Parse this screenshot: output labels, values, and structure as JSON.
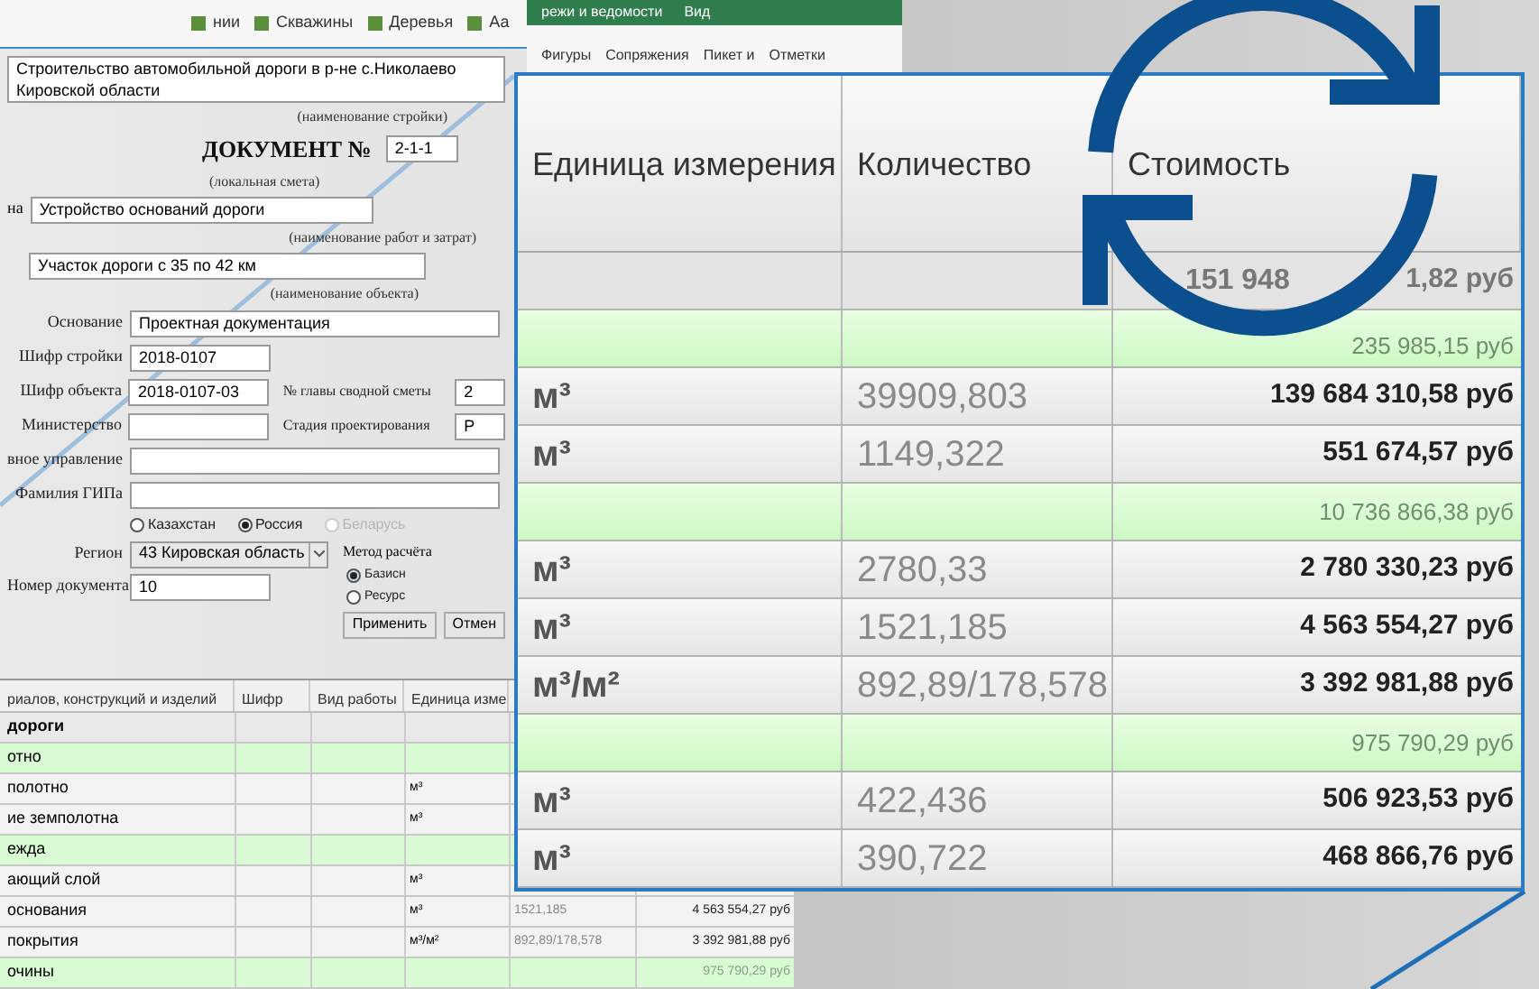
{
  "ribbon": {
    "items": [
      "нии",
      "Скважины",
      "Деревья",
      "Аа"
    ],
    "tabs": [
      "режи и ведомости",
      "Вид"
    ],
    "tools": [
      "Фигуры",
      "Сопряжения",
      "Пикет и",
      "Отметки"
    ]
  },
  "document": {
    "project": "Строительство автомобильной дороги в р-не с.Николаево Кировской области",
    "project_caption": "(наименование стройки)",
    "heading": "ДОКУМЕНТ №",
    "number": "2-1-1",
    "number_caption": "(локальная смета)",
    "work_label": "на",
    "work": "Устройство оснований дороги",
    "work_caption": "(наименование работ и затрат)",
    "object": "Участок дороги с 35 по 42 км",
    "object_caption": "(наименование объекта)",
    "fields": [
      {
        "label": "Основание",
        "value": "Проектная документация",
        "kind": "wide"
      },
      {
        "label": "Шифр стройки",
        "value": "2018-0107",
        "kind": "short"
      },
      {
        "label": "Шифр объекта",
        "value": "2018-0107-03",
        "kind": "short",
        "side": {
          "label": "№ главы сводной сметы",
          "value": "2"
        }
      },
      {
        "label": "Министерство",
        "kind": "short",
        "side": {
          "label": "Стадия проектирования",
          "value": "Р"
        }
      },
      {
        "label": "вное управление",
        "kind": "wide"
      },
      {
        "label": "Фамилия ГИПа",
        "kind": "wide"
      }
    ],
    "countries": [
      {
        "label": "Казахстан",
        "selected": false,
        "disabled": false
      },
      {
        "label": "Россия",
        "selected": true,
        "disabled": false
      },
      {
        "label": "Беларусь",
        "selected": false,
        "disabled": true
      }
    ],
    "region": {
      "label": "Регион",
      "value": "43 Кировская область"
    },
    "doc_no": {
      "label": "Номер документа",
      "value": "10"
    },
    "method": {
      "label": "Метод расчёта",
      "options": [
        {
          "label": "Базисн",
          "selected": true
        },
        {
          "label": "Ресурс",
          "selected": false
        }
      ]
    },
    "buttons": [
      "Применить",
      "Отмен"
    ]
  },
  "table": {
    "columns": [
      "риалов, конструкций и изделий",
      "Шифр",
      "Вид работы",
      "Единица изме"
    ],
    "rows": [
      {
        "kind": "section",
        "name": "дороги"
      },
      {
        "kind": "group",
        "name": "отно"
      },
      {
        "kind": "item",
        "name": "полотно",
        "unit": "м³"
      },
      {
        "kind": "item",
        "name": "ие земполотна",
        "unit": "м³"
      },
      {
        "kind": "group",
        "name": "ежда"
      },
      {
        "kind": "item",
        "name": "ающий слой",
        "unit": "м³"
      },
      {
        "kind": "item",
        "name": "основания",
        "unit": "м³",
        "quantity": "1521,185",
        "cost": "4 563 554,27 руб"
      },
      {
        "kind": "item",
        "name": "покрытия",
        "unit": "м³/м²",
        "quantity": "892,89/178,578",
        "cost": "3 392 981,88 руб"
      },
      {
        "kind": "group",
        "name": "очины",
        "cost": "975 790,29 руб"
      }
    ]
  },
  "zoomed_table": {
    "columns": [
      "Единица измерения",
      "Количество",
      "Стоимость"
    ],
    "rows": [
      {
        "kind": "total",
        "cost_lead": "151 948",
        "cost": "1,82 руб"
      },
      {
        "kind": "group",
        "cost": "235 985,15 руб"
      },
      {
        "kind": "item",
        "unit": "м³",
        "quantity": "39909,803",
        "cost": "139 684 310,58 руб"
      },
      {
        "kind": "item",
        "unit": "м³",
        "quantity": "1149,322",
        "cost": "551 674,57 руб"
      },
      {
        "kind": "group",
        "cost": "10 736 866,38 руб"
      },
      {
        "kind": "item",
        "unit": "м³",
        "quantity": "2780,33",
        "cost": "2 780 330,23 руб"
      },
      {
        "kind": "item",
        "unit": "м³",
        "quantity": "1521,185",
        "cost": "4 563 554,27 руб"
      },
      {
        "kind": "item",
        "unit": "м³/м²",
        "quantity": "892,89/178,578",
        "cost": "3 392 981,88 руб"
      },
      {
        "kind": "group",
        "cost": "975 790,29 руб"
      },
      {
        "kind": "item",
        "unit": "м³",
        "quantity": "422,436",
        "cost": "506 923,53 руб"
      },
      {
        "kind": "item",
        "unit": "м³",
        "quantity": "390,722",
        "cost": "468 866,76 руб"
      }
    ]
  }
}
